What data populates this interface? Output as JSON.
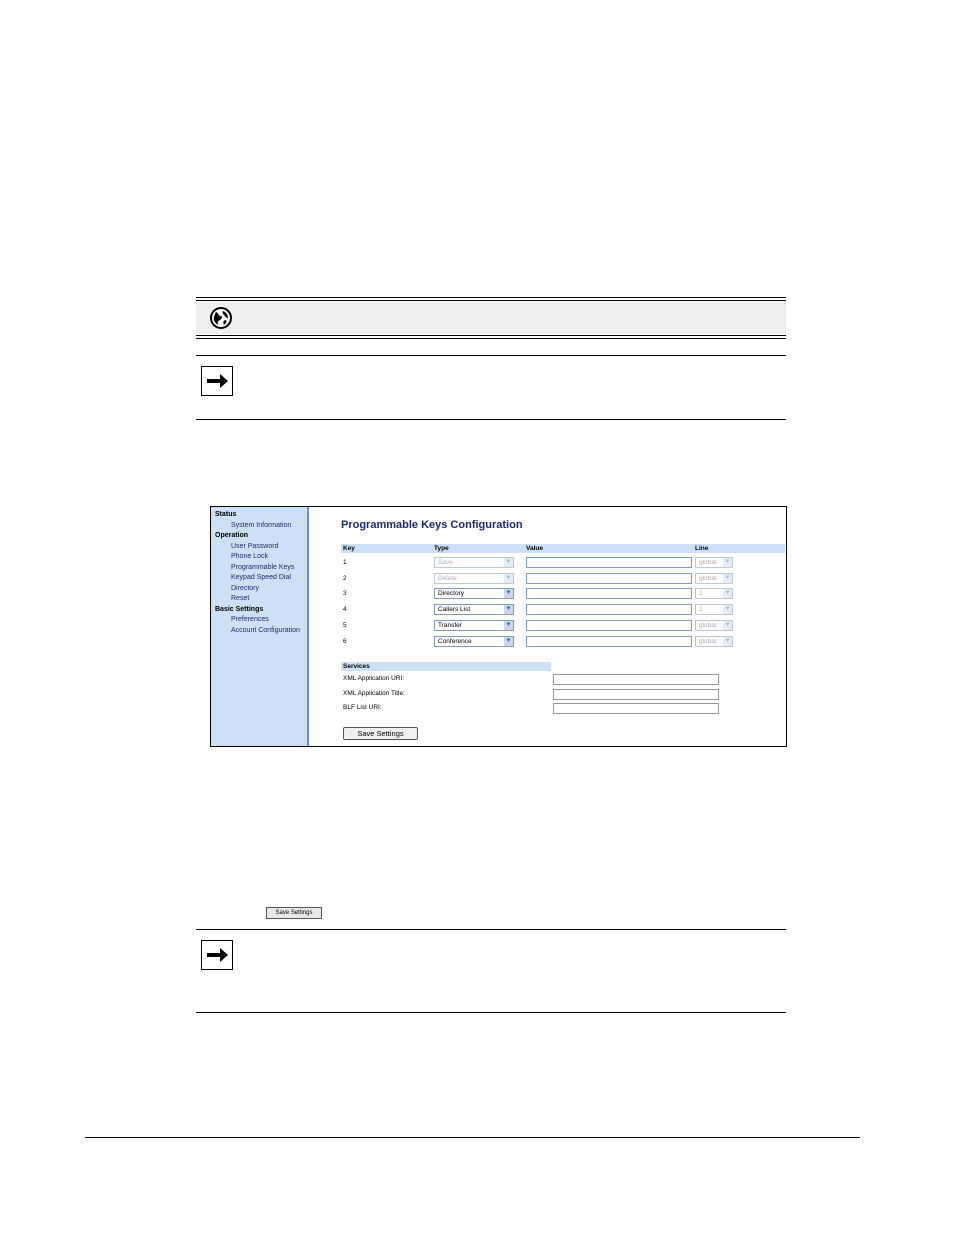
{
  "webui": {
    "title": "Programmable Keys Configuration",
    "sidebar": [
      {
        "label": "Status",
        "level": 0
      },
      {
        "label": "System Information",
        "level": 1
      },
      {
        "label": "Operation",
        "level": 0
      },
      {
        "label": "User Password",
        "level": 1
      },
      {
        "label": "Phone Lock",
        "level": 1
      },
      {
        "label": "Programmable Keys",
        "level": 1
      },
      {
        "label": "Keypad Speed Dial",
        "level": 1
      },
      {
        "label": "Directory",
        "level": 1
      },
      {
        "label": "Reset",
        "level": 1
      },
      {
        "label": "Basic Settings",
        "level": 0
      },
      {
        "label": "Preferences",
        "level": 1
      },
      {
        "label": "Account Configuration",
        "level": 1
      }
    ],
    "columns": {
      "key": "Key",
      "type": "Type",
      "value": "Value",
      "line": "Line"
    },
    "keys": [
      {
        "key": "1",
        "type": "Save",
        "type_disabled": true,
        "line": "global"
      },
      {
        "key": "2",
        "type": "Delete",
        "type_disabled": true,
        "line": "global"
      },
      {
        "key": "3",
        "type": "Directory",
        "type_disabled": false,
        "line": "1"
      },
      {
        "key": "4",
        "type": "Callers List",
        "type_disabled": false,
        "line": "1"
      },
      {
        "key": "5",
        "type": "Transfer",
        "type_disabled": false,
        "line": "global"
      },
      {
        "key": "6",
        "type": "Conference",
        "type_disabled": false,
        "line": "global"
      }
    ],
    "services": {
      "header": "Services",
      "fields": [
        "XML Application URI:",
        "XML Application Title:",
        "BLF List URI:"
      ]
    },
    "save_label": "Save Settings"
  },
  "inline_button": {
    "label": "Save Settings"
  }
}
